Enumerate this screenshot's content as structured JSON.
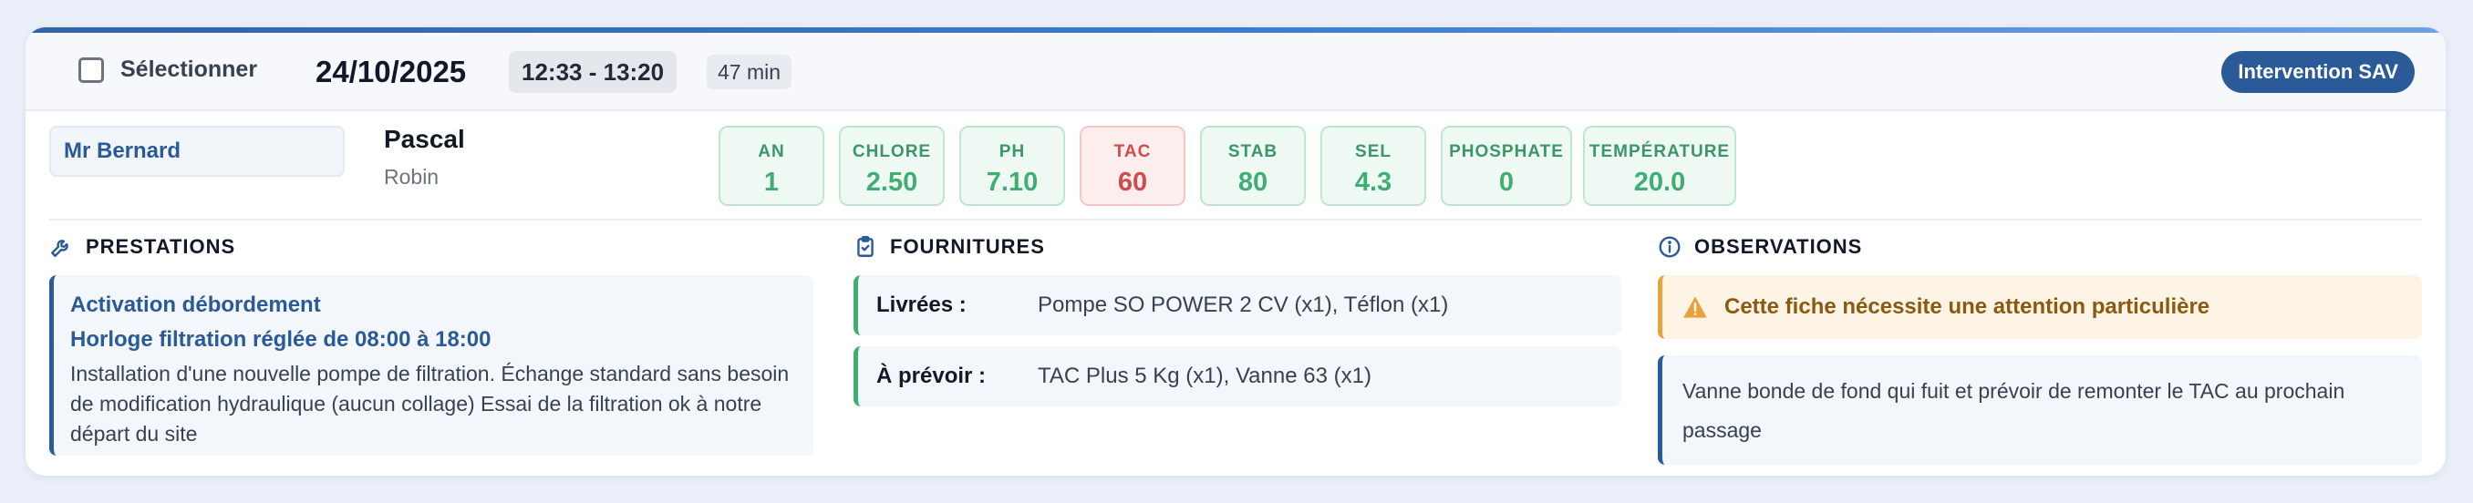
{
  "header": {
    "select_label": "Sélectionner",
    "date": "24/10/2025",
    "time_range": "12:33 - 13:20",
    "duration": "47 min",
    "badge": "Intervention SAV"
  },
  "client": {
    "title": "Mr Bernard",
    "first_name": "Pascal",
    "last_name": "Robin"
  },
  "metrics": [
    {
      "label": "AN",
      "value": "1",
      "status": "ok"
    },
    {
      "label": "CHLORE",
      "value": "2.50",
      "status": "ok"
    },
    {
      "label": "PH",
      "value": "7.10",
      "status": "ok"
    },
    {
      "label": "TAC",
      "value": "60",
      "status": "warn"
    },
    {
      "label": "STAB",
      "value": "80",
      "status": "ok"
    },
    {
      "label": "SEL",
      "value": "4.3",
      "status": "ok"
    },
    {
      "label": "PHOSPHATE",
      "value": "0",
      "status": "ok"
    },
    {
      "label": "TEMPÉRATURE",
      "value": "20.0",
      "status": "ok"
    }
  ],
  "prestations": {
    "title": "PRESTATIONS",
    "items": [
      "Activation débordement",
      "Horloge filtration réglée de 08:00 à 18:00"
    ],
    "description": "Installation d'une nouvelle pompe de filtration. Échange standard sans besoin de modification hydraulique (aucun collage) Essai de la filtration ok à notre départ du site"
  },
  "fournitures": {
    "title": "FOURNITURES",
    "rows": [
      {
        "label": "Livrées :",
        "value": "Pompe SO POWER 2 CV (x1), Téflon (x1)"
      },
      {
        "label": "À prévoir :",
        "value": "TAC Plus 5 Kg (x1), Vanne 63 (x1)"
      }
    ]
  },
  "observations": {
    "title": "OBSERVATIONS",
    "alert": "Cette fiche nécessite une attention particulière",
    "text": "Vanne bonde de fond qui fuit et prévoir de remonter le TAC au prochain passage"
  },
  "colors": {
    "accent": "#2a5b98",
    "ok": "#3fae72",
    "warn": "#d24b4b",
    "alert": "#e7a23e"
  }
}
